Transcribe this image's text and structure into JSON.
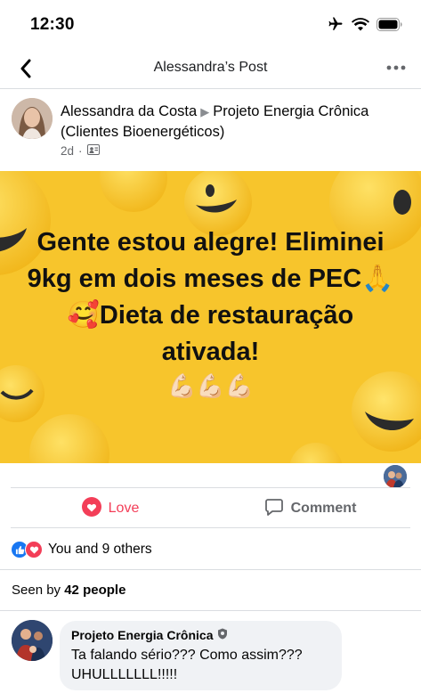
{
  "status_bar": {
    "time": "12:30",
    "icons": [
      "airplane-icon",
      "wifi-icon",
      "battery-icon"
    ]
  },
  "nav": {
    "title": "Alessandra’s Post",
    "back_icon": "chevron-left-icon",
    "more_icon": "more-dots-icon"
  },
  "post": {
    "author": "Alessandra da Costa",
    "group": "Projeto Energia Crônica (Clientes Bioenergéticos)",
    "age": "2d",
    "privacy_icon": "group-privacy-icon",
    "image_text": "Gente estou alegre! Eliminei 9kg em dois meses de PEC🙏🥰Dieta de restauração ativada!",
    "image_emojis": "💪🏻💪🏻💪🏻",
    "image_background": "#f7c52c"
  },
  "actions": {
    "love_label": "Love",
    "comment_label": "Comment",
    "love_color": "#f33e58"
  },
  "reactions": {
    "summary": "You and 9 others",
    "icons": [
      "like-icon",
      "love-icon"
    ]
  },
  "seen": {
    "prefix": "Seen by",
    "count": "42 people"
  },
  "comment": {
    "author": "Projeto Energia Crônica",
    "badge_icon": "admin-shield-icon",
    "line1": "Ta falando sério??? Como assim???",
    "line2": "UHULLLLLLL!!!!!"
  }
}
